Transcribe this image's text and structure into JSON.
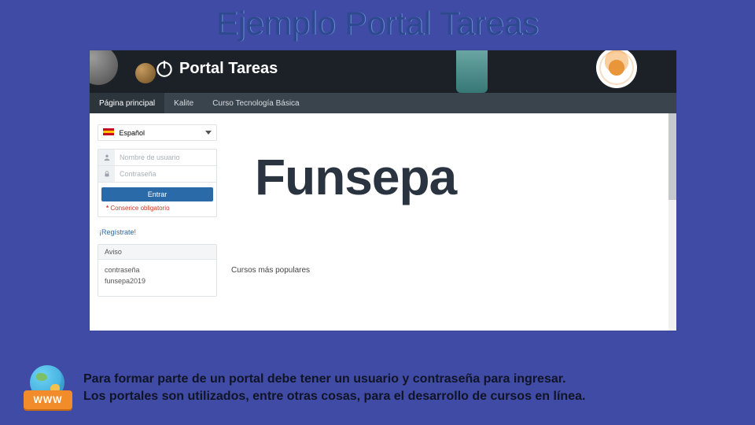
{
  "slide": {
    "title": "Ejemplo Portal Tareas"
  },
  "portal": {
    "brand": "Portal Tareas",
    "nav": [
      {
        "label": "Página principal",
        "active": true
      },
      {
        "label": "Kalite",
        "active": false
      },
      {
        "label": "Curso Tecnología Básica",
        "active": false
      }
    ],
    "language": {
      "label": "Español"
    },
    "login": {
      "username_placeholder": "Nombre de usuario",
      "password_placeholder": "Contraseña",
      "submit": "Entrar",
      "required_note": "Conserice obligatorio",
      "register": "¡Regístrate!"
    },
    "notice": {
      "header": "Aviso",
      "line1": "contraseña",
      "line2": "funsepa2019"
    },
    "main_brand": "Funsepa",
    "popular_heading": "Cursos más populares"
  },
  "footer": {
    "www": "WWW",
    "line1": "Para formar parte de un portal debe tener un usuario y contraseña para ingresar.",
    "line2": "Los portales son utilizados, entre otras cosas, para el desarrollo de cursos en línea."
  }
}
